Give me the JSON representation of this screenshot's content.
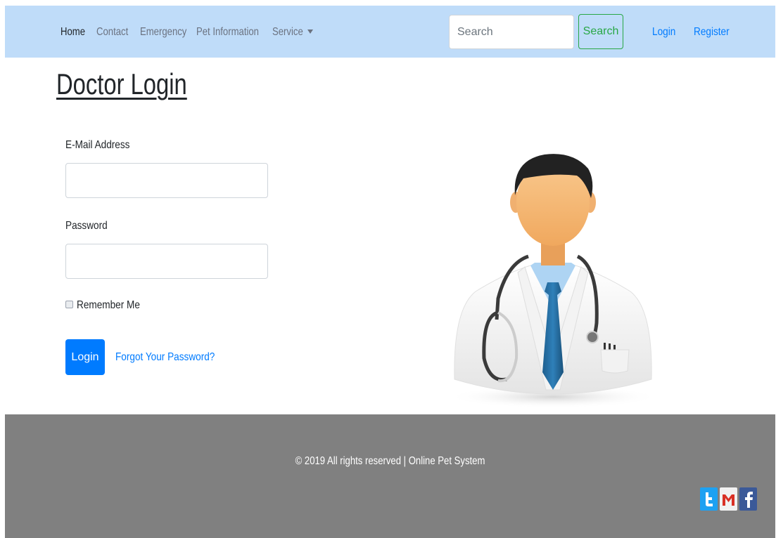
{
  "nav": {
    "items": [
      {
        "label": "Home"
      },
      {
        "label": "Contact"
      },
      {
        "label": "Emergency"
      },
      {
        "label": "Pet Information"
      },
      {
        "label": "Service"
      }
    ],
    "search": {
      "placeholder": "Search",
      "button_label": "Search"
    },
    "login_label": "Login",
    "register_label": "Register"
  },
  "page": {
    "title": "Doctor Login",
    "email_label": "E-Mail Address",
    "password_label": "Password",
    "remember_label": "Remember Me",
    "login_button": "Login",
    "forgot_link": "Forgot Your Password?"
  },
  "footer": {
    "text": "© 2019 All rights reserved | Online Pet System",
    "social_icons": [
      "twitter-icon",
      "gmail-icon",
      "facebook-icon"
    ]
  },
  "colors": {
    "navbar_bg": "#bfdcf9",
    "primary": "#007bff",
    "success": "#28a745",
    "footer_bg": "#808080"
  }
}
